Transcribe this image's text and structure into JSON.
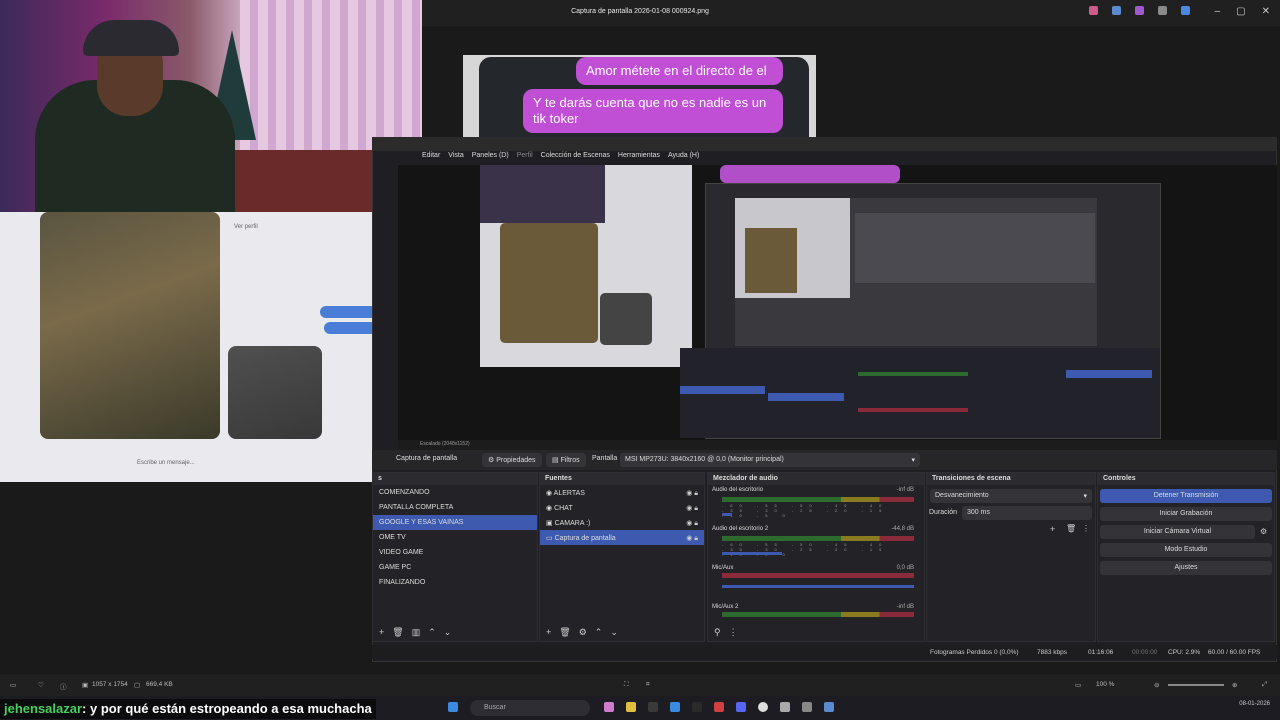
{
  "photos_app": {
    "title": "Captura de pantalla 2026-01-08 000924.png",
    "footer": {
      "dimensions": "1057 x 1754",
      "size": "669,4 KB",
      "zoom": "100 %"
    }
  },
  "chat_bubbles": [
    "Amor métete en el directo de el",
    "Y te darás cuenta que no es nadie es un tik toker"
  ],
  "left_panel": {
    "link": "Ver perfil",
    "placeholder": "Escribe un mensaje..."
  },
  "obs": {
    "menu": [
      "Editar",
      "Vista",
      "Paneles (D)",
      "Perfil",
      "Colección de Escenas",
      "Herramientas",
      "Ayuda (H)"
    ],
    "scale_label": "Escalado (2048x1152)",
    "scene_bar": {
      "source_label": "Captura de pantalla",
      "properties": "Propiedades",
      "filters": "Filtros",
      "screen_label": "Pantalla",
      "screen_value": "MSI MP273U: 3840x2160 @ 0,0 (Monitor principal)"
    },
    "scenes": {
      "items": [
        "COMENZANDO",
        "PANTALLA COMPLETA",
        "GOOGLE Y ESAS VAINAS",
        "OME TV",
        "VIDEO GAME",
        "GAME PC",
        "FINALIZANDO"
      ],
      "selected_index": 2
    },
    "sources": {
      "title": "Fuentes",
      "items": [
        "ALERTAS",
        "CHAT",
        "CAMARA :)",
        "Captura de pantalla"
      ],
      "selected_index": 3
    },
    "mixer": {
      "title": "Mezclador de audio",
      "tracks": [
        {
          "name": "Audio del escritorio",
          "db": "-inf dB"
        },
        {
          "name": "Audio del escritorio 2",
          "db": "-44,8 dB"
        },
        {
          "name": "Mic/Aux",
          "db": "0,0 dB"
        },
        {
          "name": "Mic/Aux 2",
          "db": "-inf dB"
        }
      ],
      "ticks": "-60 -55 -50 -45 -40 -35 -30 -25 -20 -15 -10 -5 0"
    },
    "transitions": {
      "title": "Transiciones de escena",
      "type": "Desvanecimiento",
      "duration_label": "Duración",
      "duration_value": "300 ms"
    },
    "controls": {
      "title": "Controles",
      "buttons": [
        "Detener Transmisión",
        "Iniciar Grabación",
        "Iniciar Cámara Virtual",
        "Modo Estudio",
        "Ajustes"
      ]
    },
    "status": {
      "dropped": "Fotogramas Perdidos 0 (0,0%)",
      "bitrate": "7883 kbps",
      "stream_time": "01:16:06",
      "rec_time": "00:00:00",
      "cpu": "CPU: 2.9%",
      "fps": "60.00 / 60.00 FPS"
    }
  },
  "taskbar": {
    "search": "Buscar",
    "date": "08-01-2026"
  },
  "stream_chat": {
    "user": "jehensalazar",
    "message": ": y por qué están estropeando a esa muchacha"
  }
}
